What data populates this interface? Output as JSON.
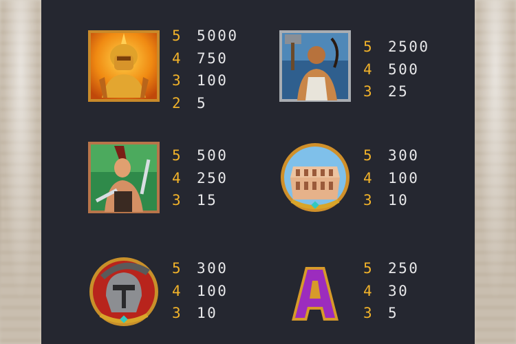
{
  "paytable": [
    {
      "symbol": "golden-spartan-icon",
      "pays": [
        {
          "count": "5",
          "value": "5000"
        },
        {
          "count": "4",
          "value": "750"
        },
        {
          "count": "3",
          "value": "100"
        },
        {
          "count": "2",
          "value": "5"
        }
      ]
    },
    {
      "symbol": "hammer-gladiator-icon",
      "pays": [
        {
          "count": "5",
          "value": "2500"
        },
        {
          "count": "4",
          "value": "500"
        },
        {
          "count": "3",
          "value": "25"
        }
      ]
    },
    {
      "symbol": "sword-gladiator-icon",
      "pays": [
        {
          "count": "5",
          "value": "500"
        },
        {
          "count": "4",
          "value": "250"
        },
        {
          "count": "3",
          "value": "15"
        }
      ]
    },
    {
      "symbol": "colosseum-icon",
      "pays": [
        {
          "count": "5",
          "value": "300"
        },
        {
          "count": "4",
          "value": "100"
        },
        {
          "count": "3",
          "value": "10"
        }
      ]
    },
    {
      "symbol": "helmet-icon",
      "pays": [
        {
          "count": "5",
          "value": "300"
        },
        {
          "count": "4",
          "value": "100"
        },
        {
          "count": "3",
          "value": "10"
        }
      ]
    },
    {
      "symbol": "letter-a-icon",
      "pays": [
        {
          "count": "5",
          "value": "250"
        },
        {
          "count": "4",
          "value": "30"
        },
        {
          "count": "3",
          "value": "5"
        }
      ]
    }
  ],
  "colors": {
    "panel": "#252730",
    "count": "#f2b32a",
    "value": "#e8e8ea"
  },
  "letter_symbol": "A"
}
